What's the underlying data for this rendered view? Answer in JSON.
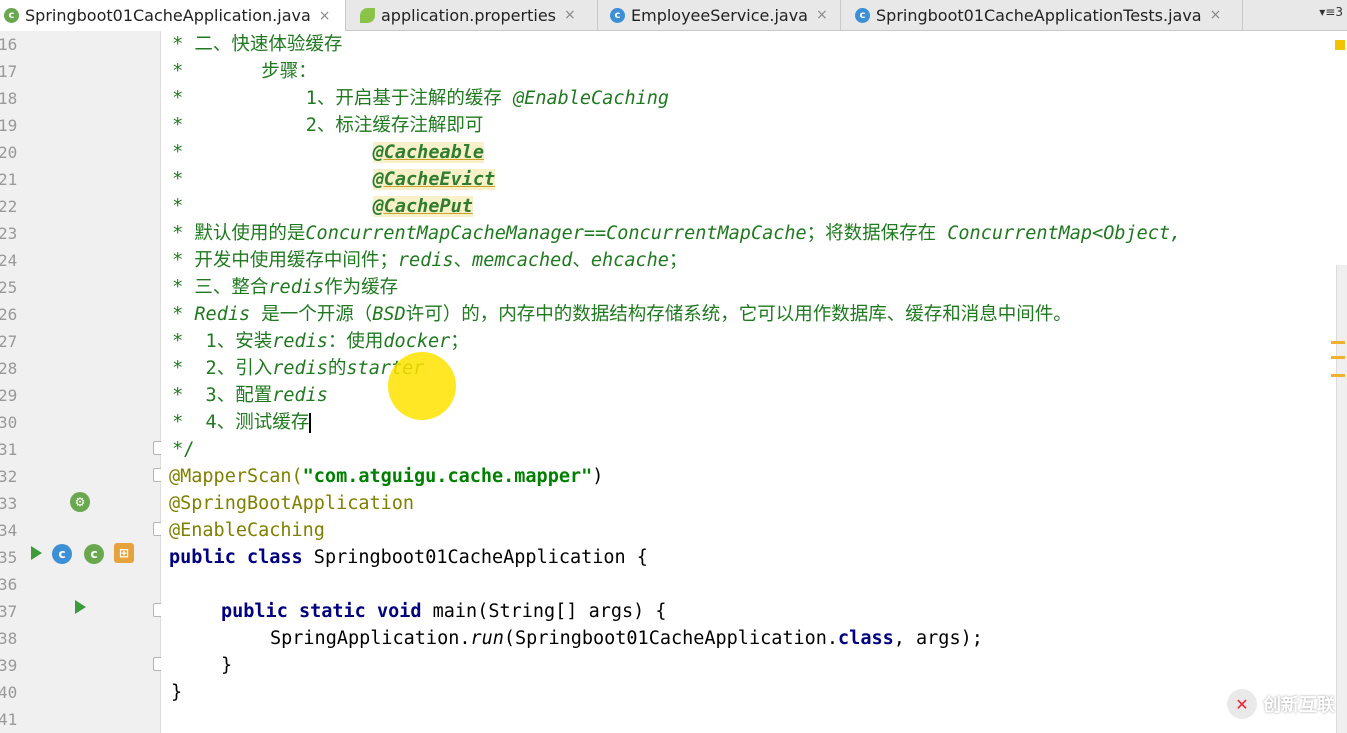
{
  "tabs": [
    {
      "label": "Springboot01CacheApplication.java",
      "icon": "spring-class-icon",
      "active": true
    },
    {
      "label": "application.properties",
      "icon": "properties-leaf-icon",
      "active": false
    },
    {
      "label": "EmployeeService.java",
      "icon": "class-icon",
      "active": false
    },
    {
      "label": "Springboot01CacheApplicationTests.java",
      "icon": "test-class-icon",
      "active": false
    }
  ],
  "tab_close": "×",
  "tab_menu": "▾≡3",
  "line_numbers": [
    "16",
    "17",
    "18",
    "19",
    "20",
    "21",
    "22",
    "23",
    "24",
    "25",
    "26",
    "27",
    "28",
    "29",
    "30",
    "31",
    "32",
    "33",
    "34",
    "35",
    "36",
    "37",
    "38",
    "39",
    "40",
    "41"
  ],
  "comment": {
    "l16": " * 二、快速体验缓存",
    "l17": " *       步骤：",
    "l18a": " *           1、开启基于注解的缓存 ",
    "l18b": "@EnableCaching",
    "l19": " *           2、标注缓存注解即可",
    "l20a": " *                 ",
    "l20b": "@Cacheable",
    "l21a": " *                 ",
    "l21b": "@CacheEvict",
    "l22a": " *                 ",
    "l22b": "@CachePut",
    "l23a": " * 默认使用的是",
    "l23b": "ConcurrentMapCacheManager==ConcurrentMapCache",
    "l23c": "；将数据保存在 ",
    "l23d": "ConcurrentMap<Object,",
    "l24a": " * 开发中使用缓存中间件；",
    "l24b": "redis",
    "l24c": "、",
    "l24d": "memcached",
    "l24e": "、",
    "l24f": "ehcache",
    "l24g": "；",
    "l25a": " * 三、整合",
    "l25b": "redis",
    "l25c": "作为缓存",
    "l26a": " * ",
    "l26b": "Redis",
    "l26c": " 是一个开源（",
    "l26d": "BSD",
    "l26e": "许可）的，内存中的数据结构存储系统，它可以用作数据库、缓存和消息中间件。",
    "l27a": " *  1、安装",
    "l27b": "redis",
    "l27c": "：使用",
    "l27d": "docker",
    "l27e": "；",
    "l28a": " *  2、引入",
    "l28b": "redis",
    "l28c": "的",
    "l28d": "starter",
    "l29a": " *  3、配置",
    "l29b": "redis",
    "l30": " *  4、测试缓存",
    "l31": " */"
  },
  "code": {
    "ann_mapper": "@MapperScan(",
    "mapper_str": "\"com.atguigu.cache.mapper\"",
    "close_paren": ")",
    "ann_boot": "@SpringBootApplication",
    "ann_cache": "@EnableCaching",
    "kw_public": "public",
    "kw_class": "class",
    "class_name": " Springboot01CacheApplication {",
    "kw_static": "static",
    "kw_void": "void",
    "main_sig": " main(String[] args) {",
    "run_prefix": "SpringApplication.",
    "run_method": "run",
    "run_arg": "(Springboot01CacheApplication.",
    "kw_class2": "class",
    "run_suffix": ", args);",
    "close_inner": "}",
    "close_outer": "}"
  },
  "watermark": {
    "text": "创新互联",
    "logo": "✕"
  }
}
